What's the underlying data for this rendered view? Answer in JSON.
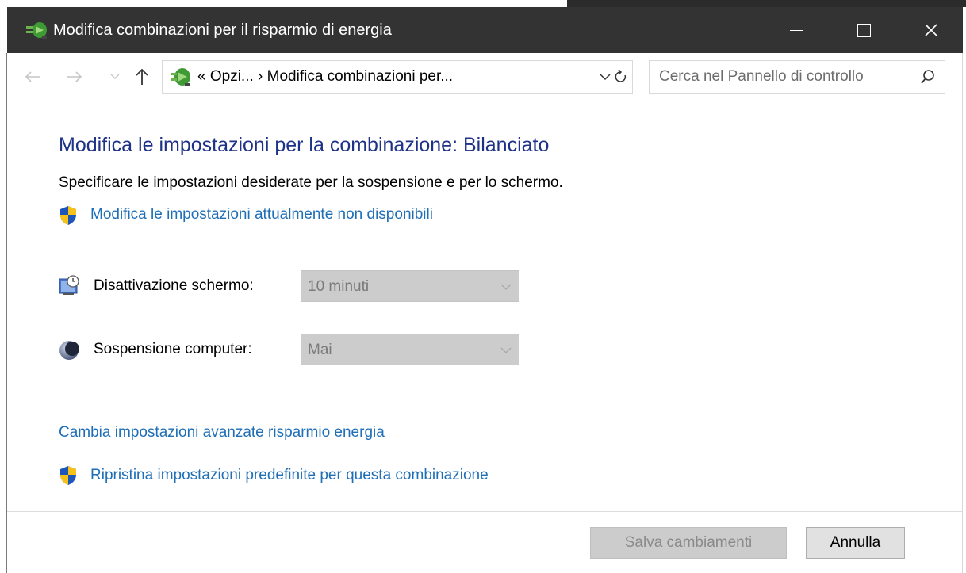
{
  "window": {
    "title": "Modifica combinazioni per il risparmio di energia"
  },
  "address_bar": {
    "text": "«  Opzi...  ›  Modifica combinazioni per..."
  },
  "search": {
    "placeholder": "Cerca nel Pannello di controllo"
  },
  "content": {
    "heading": "Modifica le impostazioni per la combinazione: Bilanciato",
    "subtitle": "Specificare le impostazioni desiderate per la sospensione e per lo schermo.",
    "unavailable_link": "Modifica le impostazioni attualmente non disponibili",
    "settings": [
      {
        "label": "Disattivazione schermo:",
        "value": "10 minuti",
        "icon": "display-timer-icon"
      },
      {
        "label": "Sospensione computer:",
        "value": "Mai",
        "icon": "sleep-moon-icon"
      }
    ],
    "advanced_link": "Cambia impostazioni avanzate risparmio energia",
    "restore_link": "Ripristina impostazioni predefinite per questa combinazione"
  },
  "footer": {
    "save_label": "Salva cambiamenti",
    "cancel_label": "Annulla"
  },
  "colors": {
    "titlebar": "#333333",
    "heading": "#1e3287",
    "link": "#1f6fb7",
    "disabled_fill": "#cccccc"
  }
}
